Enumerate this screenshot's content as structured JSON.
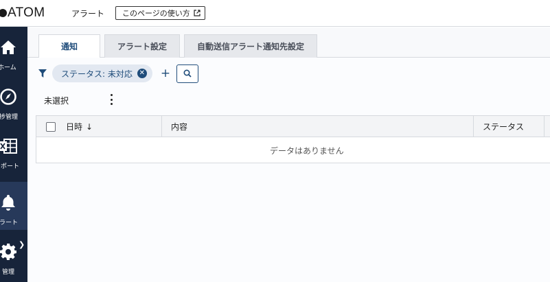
{
  "app": {
    "logo_text": "ATOM",
    "page_name": "アラート",
    "howto_label": "このページの使い方"
  },
  "sidebar": {
    "items": [
      {
        "label": "ホーム",
        "icon": "home-icon"
      },
      {
        "label": "進捗管理",
        "icon": "progress-icon"
      },
      {
        "label": "レポート",
        "icon": "excel-report-icon"
      },
      {
        "label": "アラート",
        "icon": "bell-icon",
        "active": true
      },
      {
        "label": "管理",
        "icon": "gear-icon"
      }
    ]
  },
  "tabs": [
    {
      "label": "通知",
      "active": true
    },
    {
      "label": "アラート設定",
      "active": false
    },
    {
      "label": "自動送信アラート通知先設定",
      "active": false
    }
  ],
  "filter": {
    "chip_label": "ステータス: 未対応"
  },
  "selection": {
    "label": "未選択"
  },
  "table": {
    "columns": [
      "日時",
      "内容",
      "ステータス"
    ],
    "sort_indicator": "↓",
    "empty_text": "データはありません"
  },
  "colors": {
    "sidebar_bg": "#17243a",
    "accent": "#1f4c7a",
    "chip_bg": "#e2e8f1"
  }
}
